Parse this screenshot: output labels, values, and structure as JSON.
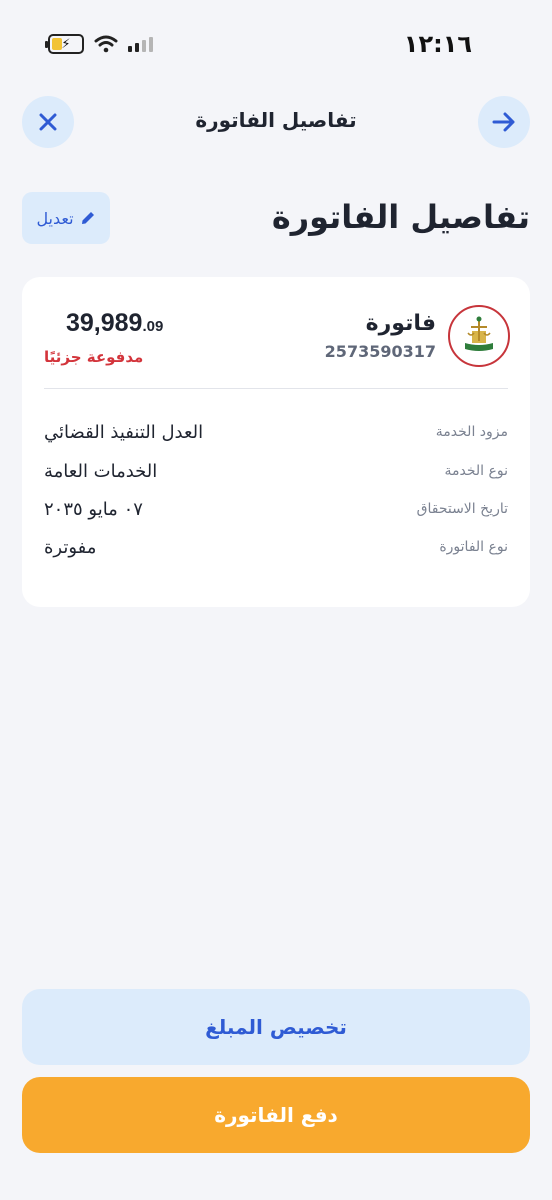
{
  "status_bar": {
    "time": "١٢:١٦",
    "battery_icon": "battery-charging-icon",
    "wifi_icon": "wifi-icon",
    "signal_icon": "signal-icon"
  },
  "nav": {
    "title": "تفاصيل الفاتورة",
    "close_icon": "close-icon",
    "forward_icon": "arrow-right-icon"
  },
  "header": {
    "title": "تفاصيل الفاتورة",
    "edit_label": "تعديل",
    "edit_icon": "pencil-icon"
  },
  "invoice": {
    "label": "فاتورة",
    "number": "2573590317",
    "amount_main": "39,989",
    "amount_fraction": ".09",
    "status": "مدفوعة جزئيًا",
    "logo_icon": "ministry-of-justice-logo"
  },
  "details": [
    {
      "label": "مزود الخدمة",
      "value": "العدل التنفيذ القضائي"
    },
    {
      "label": "نوع الخدمة",
      "value": "الخدمات العامة"
    },
    {
      "label": "تاريخ الاستحقاق",
      "value": "٠٧ مايو ٢٠٣٥"
    },
    {
      "label": "نوع الفاتورة",
      "value": "مفوترة"
    }
  ],
  "actions": {
    "allocate_label": "تخصيص المبلغ",
    "pay_label": "دفع الفاتورة"
  },
  "colors": {
    "background": "#f4f5f9",
    "accent_blue": "#2f5bd4",
    "light_blue": "#dcebfb",
    "pay_orange": "#f8a92e",
    "status_red": "#d3343b"
  }
}
